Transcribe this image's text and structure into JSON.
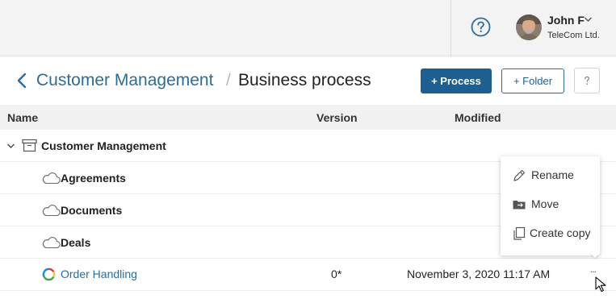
{
  "topbar": {
    "help_icon": "question-circle-icon",
    "user_name": "John F",
    "user_company": "TeleCom Ltd."
  },
  "header": {
    "breadcrumb_parent": "Customer Management",
    "breadcrumb_separator": "/",
    "title": "Business process",
    "process_button": "+ Process",
    "folder_button": "+ Folder",
    "help_button": "?"
  },
  "table": {
    "columns": [
      "Name",
      "Version",
      "Modified"
    ],
    "rows": [
      {
        "name": "Customer Management",
        "icon": "archive-folder-icon",
        "version": "",
        "modified": ""
      },
      {
        "name": "Agreements",
        "icon": "cloud-icon",
        "version": "",
        "modified": ""
      },
      {
        "name": "Documents",
        "icon": "cloud-icon",
        "version": "",
        "modified": ""
      },
      {
        "name": "Deals",
        "icon": "cloud-icon",
        "version": "",
        "modified": ""
      },
      {
        "name": "Order Handling",
        "icon": "process-ring-icon",
        "version": "0*",
        "modified": "November 3, 2020 11:17 AM",
        "more": "..."
      }
    ]
  },
  "context_menu": {
    "items": [
      {
        "label": "Rename",
        "icon": "pencil-icon"
      },
      {
        "label": "Move",
        "icon": "move-folder-icon"
      },
      {
        "label": "Create copy",
        "icon": "copy-icon"
      }
    ]
  },
  "colors": {
    "accent": "#1e5f91",
    "link": "#2c6c99",
    "topbar_bg": "#f3f3f3",
    "header_bg": "#f1f1f1"
  }
}
